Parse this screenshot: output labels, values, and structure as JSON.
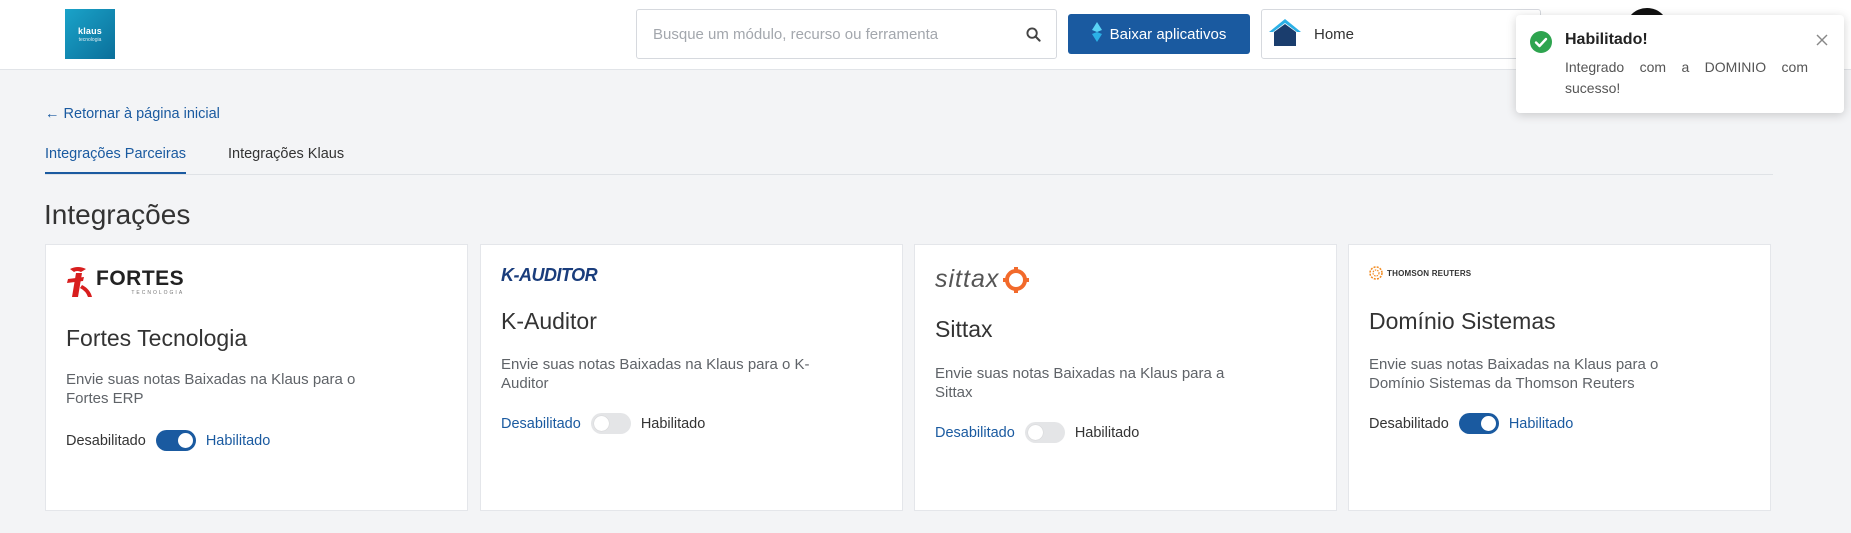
{
  "header": {
    "logo_text": "klaus",
    "logo_subtext": "tecnologia",
    "search": {
      "placeholder": "Busque um módulo, recurso ou ferramenta",
      "value": ""
    },
    "download_button": "Baixar aplicativos",
    "home_label": "Home"
  },
  "nav": {
    "back_link": "← Retornar à página inicial",
    "tabs": [
      {
        "label": "Integrações Parceiras",
        "active": true
      },
      {
        "label": "Integrações Klaus",
        "active": false
      }
    ]
  },
  "page": {
    "title": "Integrações"
  },
  "cards": [
    {
      "logo_text": "FORTES",
      "logo_subtext": "TECNOLOGIA",
      "title": "Fortes Tecnologia",
      "description": "Envie suas notas Baixadas na Klaus para o Fortes ERP",
      "off_label": "Desabilitado",
      "on_label": "Habilitado",
      "enabled": true
    },
    {
      "logo_text": "K-AUDITOR",
      "title": "K-Auditor",
      "description": "Envie suas notas Baixadas na Klaus para o K-Auditor",
      "off_label": "Desabilitado",
      "on_label": "Habilitado",
      "enabled": false
    },
    {
      "logo_text": "sittax",
      "title": "Sittax",
      "description": "Envie suas notas Baixadas na Klaus para a Sittax",
      "off_label": "Desabilitado",
      "on_label": "Habilitado",
      "enabled": false
    },
    {
      "logo_text": "THOMSON REUTERS",
      "title": "Domínio Sistemas",
      "description": "Envie suas notas Baixadas na Klaus para o Domínio Sistemas da Thomson Reuters",
      "off_label": "Desabilitado",
      "on_label": "Habilitado",
      "enabled": true
    }
  ],
  "toast": {
    "title": "Habilitado!",
    "message": "Integrado com a DOMINIO com sucesso!"
  },
  "colors": {
    "primary": "#1a5aa0",
    "success": "#2ea44f",
    "fortes_red": "#d81e1e",
    "sittax_orange": "#f26a2b",
    "reuters_orange": "#f28a1e"
  },
  "icons": {
    "search": "search-icon",
    "download": "download-icon",
    "home": "home-icon",
    "check": "check-circle-icon",
    "close": "close-icon"
  }
}
